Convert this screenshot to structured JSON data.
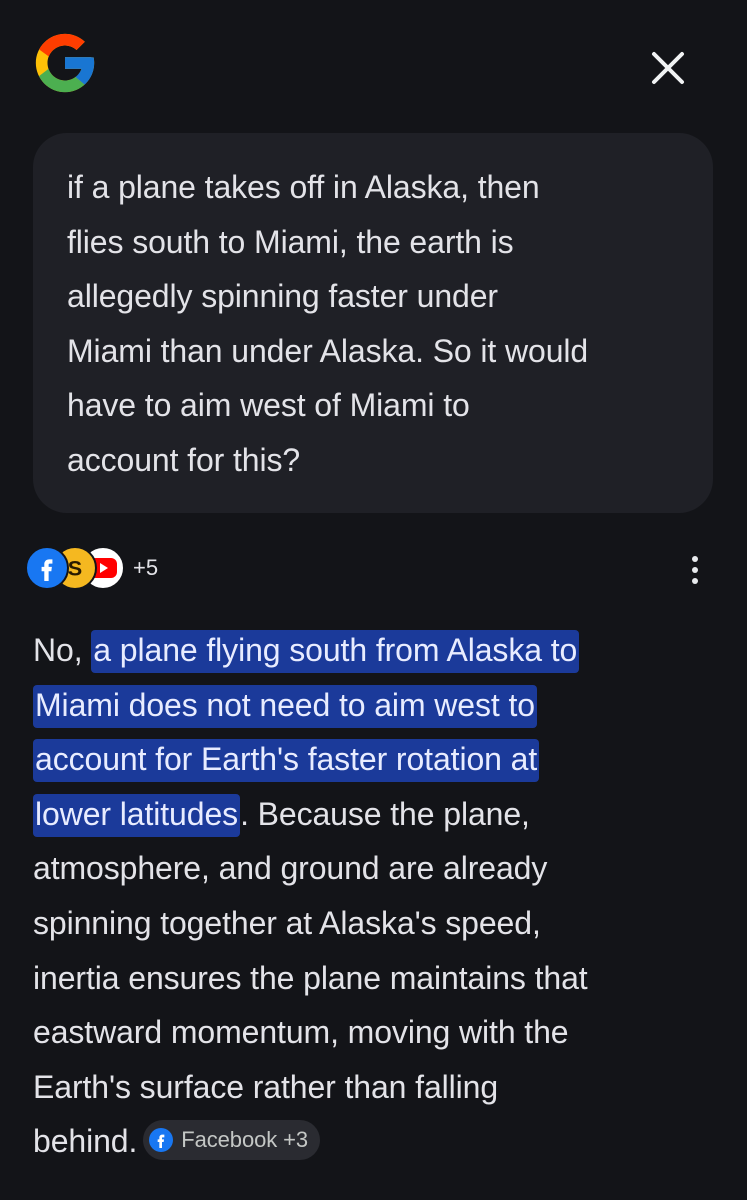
{
  "header": {
    "logo": "google-g-logo",
    "close_icon": "close-icon"
  },
  "query": {
    "lines": [
      "if a plane takes off in Alaska, then",
      "flies south to Miami, the earth is",
      "allegedly spinning faster under",
      "Miami than under Alaska. So it would",
      "have to aim west of Miami to",
      "account for this?"
    ]
  },
  "sources": {
    "icons": [
      "facebook-icon",
      "s-site-icon",
      "youtube-icon"
    ],
    "extra_count": "+5",
    "more_icon": "more-vert-icon"
  },
  "answer": {
    "intro": "No, ",
    "highlight_lines": [
      "a plane flying south from Alaska to",
      "Miami does not need to aim west to",
      "account for Earth's faster rotation at",
      "lower latitudes"
    ],
    "after_highlight": ". Because the plane,",
    "lines": [
      "atmosphere, and ground are already",
      "spinning together at Alaska's speed,",
      "inertia ensures the plane maintains that",
      "eastward momentum, moving with the",
      "Earth's surface rather than falling"
    ],
    "last_line": "behind.",
    "chip": {
      "icon": "facebook-icon",
      "label": "Facebook +3"
    }
  },
  "colors": {
    "background": "#131418",
    "card": "#1f2026",
    "highlight": "#1b3a9a",
    "chip": "#2a2b31"
  }
}
